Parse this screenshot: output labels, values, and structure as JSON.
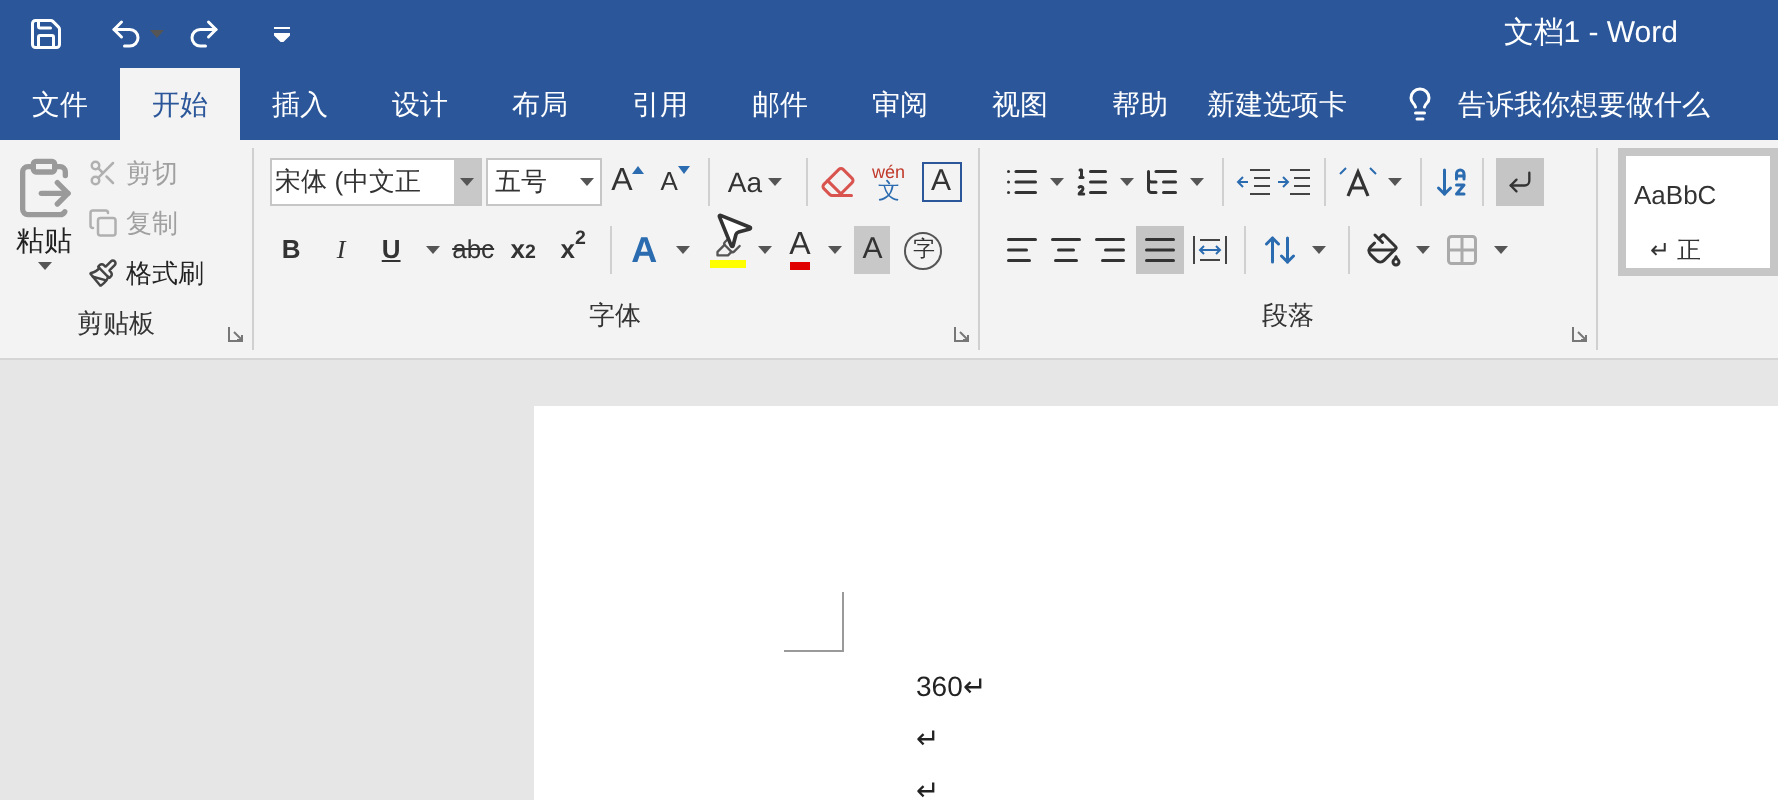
{
  "title_bar": {
    "title": "文档1 - Word"
  },
  "tabs": [
    {
      "label": "文件",
      "selected": false
    },
    {
      "label": "开始",
      "selected": true
    },
    {
      "label": "插入",
      "selected": false
    },
    {
      "label": "设计",
      "selected": false
    },
    {
      "label": "布局",
      "selected": false
    },
    {
      "label": "引用",
      "selected": false
    },
    {
      "label": "邮件",
      "selected": false
    },
    {
      "label": "审阅",
      "selected": false
    },
    {
      "label": "视图",
      "selected": false
    },
    {
      "label": "帮助",
      "selected": false
    },
    {
      "label": "新建选项卡",
      "selected": false
    }
  ],
  "tell_me": {
    "placeholder": "告诉我你想要做什么"
  },
  "clipboard": {
    "paste": "粘贴",
    "cut": {
      "label": "剪切",
      "disabled": true
    },
    "copy": {
      "label": "复制",
      "disabled": true
    },
    "format_painter": {
      "label": "格式刷",
      "disabled": false
    },
    "group_label": "剪贴板"
  },
  "font": {
    "font_name": "宋体 (中文正",
    "font_size": "五号",
    "grow": "A",
    "shrink": "A",
    "change_case": "Aa",
    "phonetic_guide": {
      "top": "wén",
      "bottom": "文"
    },
    "character_border": "A",
    "format_buttons": [
      {
        "kind": "bold",
        "label": "B"
      },
      {
        "kind": "italic",
        "label": "I"
      },
      {
        "kind": "underline",
        "label": "U"
      },
      {
        "kind": "strikethrough",
        "label": "abc"
      },
      {
        "kind": "subscript",
        "label": "x$_{2}$"
      },
      {
        "kind": "superscript",
        "label": "x$^{2}$"
      }
    ],
    "text_effects": "A",
    "font_color": "A",
    "character_shading": "A",
    "enclose": "字",
    "group_label": "字体"
  },
  "paragraph": {
    "group_label": "段落",
    "justify": {
      "selected": true
    },
    "show_marks": {
      "selected": true
    }
  },
  "styles": {
    "preview": "AaBbC",
    "name": "↵ 正"
  },
  "document": {
    "lines": [
      "360↵",
      "↵",
      "↵"
    ]
  }
}
